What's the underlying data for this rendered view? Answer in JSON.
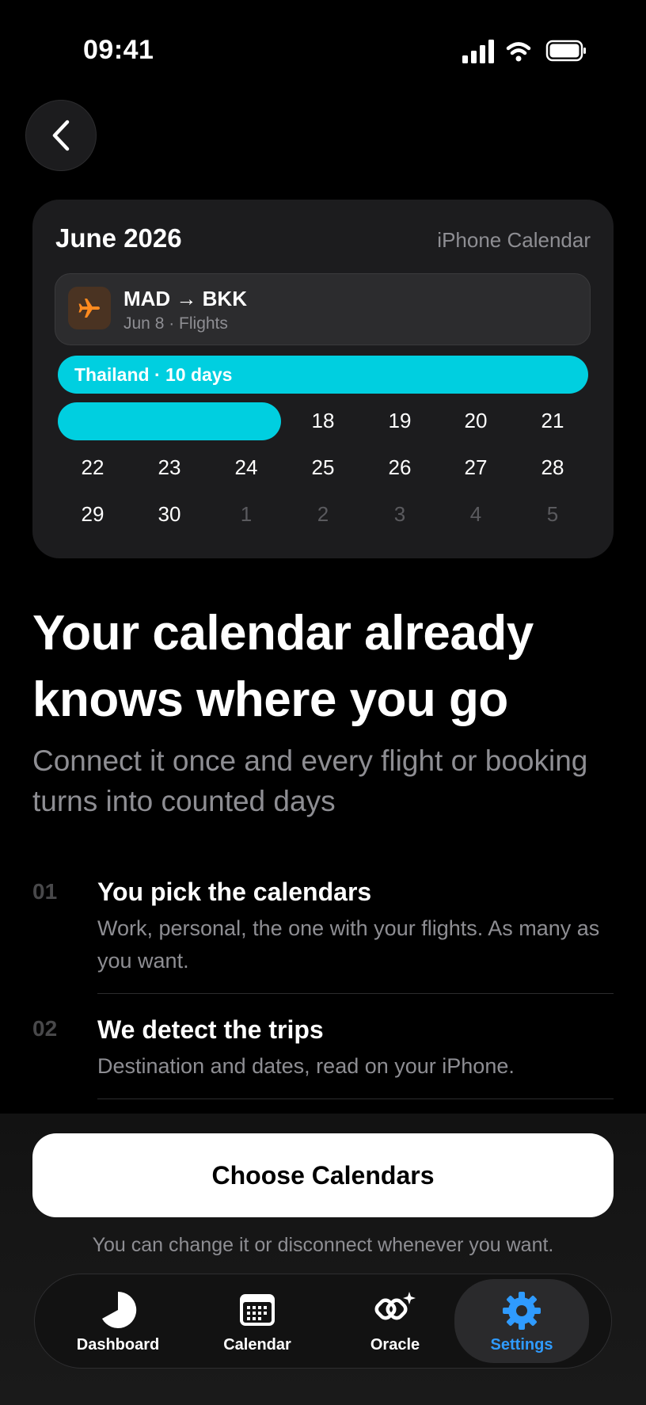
{
  "status_bar": {
    "time": "09:41",
    "icons": [
      "signal-icon",
      "wifi-icon",
      "battery-icon"
    ]
  },
  "calendar_card": {
    "month": "June 2026",
    "source": "iPhone Calendar",
    "event": {
      "route": "MAD → BKK",
      "subtitle": "Jun 8 · Flights",
      "icon": "airplane-icon"
    },
    "trip_label": "Thailand · 10 days",
    "weeks": [
      {
        "days": [
          "18",
          "19",
          "20",
          "21"
        ],
        "dim": [
          false,
          false,
          false,
          false
        ]
      },
      {
        "days": [
          "22",
          "23",
          "24",
          "25",
          "26",
          "27",
          "28"
        ],
        "dim": [
          false,
          false,
          false,
          false,
          false,
          false,
          false
        ]
      },
      {
        "days": [
          "29",
          "30",
          "1",
          "2",
          "3",
          "4",
          "5"
        ],
        "dim": [
          false,
          false,
          true,
          true,
          true,
          true,
          true
        ]
      }
    ],
    "colors": {
      "trip_bar": "#00cfe0",
      "flight_icon": "#ff8a1f"
    }
  },
  "headline": "Your calendar already knows where you go",
  "subheadline": "Connect it once and every flight or booking turns into counted days",
  "steps": [
    {
      "number": "01",
      "title": "You pick the calendars",
      "description": "Work, personal, the one with your flights. As many as you want."
    },
    {
      "number": "02",
      "title": "We detect the trips",
      "description": "Destination and dates, read on your iPhone."
    }
  ],
  "cta": {
    "label": "Choose Calendars",
    "note": "You can change it or disconnect whenever you want."
  },
  "tab_bar": {
    "items": [
      {
        "label": "Dashboard",
        "icon": "pie-chart-icon",
        "active": false
      },
      {
        "label": "Calendar",
        "icon": "calendar-icon",
        "active": false
      },
      {
        "label": "Oracle",
        "icon": "oracle-icon",
        "active": false
      },
      {
        "label": "Settings",
        "icon": "gear-icon",
        "active": true
      }
    ],
    "active_color": "#2f9bff"
  }
}
